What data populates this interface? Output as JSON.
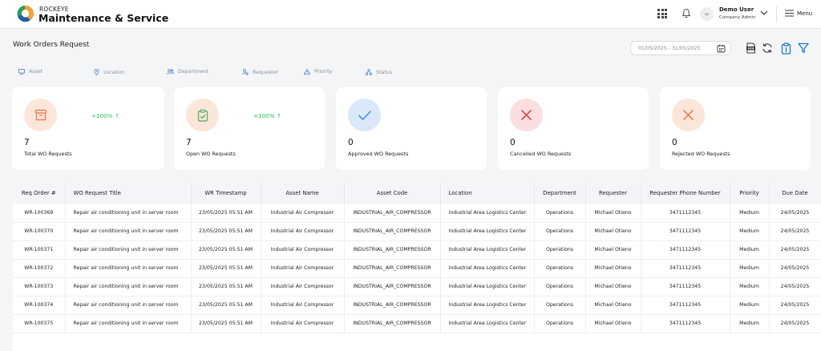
{
  "header": {
    "brand_small": "ROCKEYE",
    "brand_title": "Maintenance & Service",
    "user_name": "Demo User",
    "user_role": "Company Admin",
    "menu_label": "Menu"
  },
  "page": {
    "title": "Work Orders Request",
    "date_range": "01/05/2025 - 31/05/2025"
  },
  "filters": [
    "Asset",
    "Location",
    "Department",
    "Requester",
    "Priority",
    "Status"
  ],
  "cards": [
    {
      "value": "7",
      "label": "Total WO Requests",
      "trend": "+100% ↑",
      "icon": "package-icon",
      "color": "#e8825a"
    },
    {
      "value": "7",
      "label": "Open WO Requests",
      "trend": "+100% ↑",
      "icon": "clipboard-check-icon",
      "color": "#5fb36a"
    },
    {
      "value": "0",
      "label": "Approved WO Requests",
      "trend": "",
      "icon": "check-icon",
      "color": "#4a90e2"
    },
    {
      "value": "0",
      "label": "Cancelled WO Requests",
      "trend": "",
      "icon": "x-icon",
      "color": "#e04a4a"
    },
    {
      "value": "0",
      "label": "Rejected WO Requests",
      "trend": "",
      "icon": "x-icon",
      "color": "#e8825a"
    }
  ],
  "table": {
    "columns": [
      "Req Order #",
      "WO Request Title",
      "WR Timestamp",
      "Asset Name",
      "Asset Code",
      "Location",
      "Department",
      "Requester",
      "Requester Phone Number",
      "Priority",
      "Due Date"
    ],
    "rows": [
      [
        "WR-100369",
        "Repair air conditioning unit in server room",
        "23/05/2025 05:51 AM",
        "Industrial Air Compressor",
        "INDUSTRIAL_AIR_COMPRESSOR",
        "Industrial Area Logistics Center",
        "Operations",
        "Michael Otieno",
        "3471112345",
        "Medium",
        "24/05/2025"
      ],
      [
        "WR-100370",
        "Repair air conditioning unit in server room",
        "23/05/2025 05:51 AM",
        "Industrial Air Compressor",
        "INDUSTRIAL_AIR_COMPRESSOR",
        "Industrial Area Logistics Center",
        "Operations",
        "Michael Otieno",
        "3471112345",
        "Medium",
        "24/05/2025"
      ],
      [
        "WR-100371",
        "Repair air conditioning unit in server room",
        "23/05/2025 05:51 AM",
        "Industrial Air Compressor",
        "INDUSTRIAL_AIR_COMPRESSOR",
        "Industrial Area Logistics Center",
        "Operations",
        "Michael Otieno",
        "3471112345",
        "Medium",
        "24/05/2025"
      ],
      [
        "WR-100372",
        "Repair air conditioning unit in server room",
        "23/05/2025 05:51 AM",
        "Industrial Air Compressor",
        "INDUSTRIAL_AIR_COMPRESSOR",
        "Industrial Area Logistics Center",
        "Operations",
        "Michael Otieno",
        "3471112345",
        "Medium",
        "24/05/2025"
      ],
      [
        "WR-100373",
        "Repair air conditioning unit in server room",
        "23/05/2025 05:51 AM",
        "Industrial Air Compressor",
        "INDUSTRIAL_AIR_COMPRESSOR",
        "Industrial Area Logistics Center",
        "Operations",
        "Michael Otieno",
        "3471112345",
        "Medium",
        "24/05/2025"
      ],
      [
        "WR-100374",
        "Repair air conditioning unit in server room",
        "23/05/2025 05:51 AM",
        "Industrial Air Compressor",
        "INDUSTRIAL_AIR_COMPRESSOR",
        "Industrial Area Logistics Center",
        "Operations",
        "Michael Otieno",
        "3471112345",
        "Medium",
        "24/05/2025"
      ],
      [
        "WR-100375",
        "Repair air conditioning unit in server room",
        "23/05/2025 05:51 AM",
        "Industrial Air Compressor",
        "INDUSTRIAL_AIR_COMPRESSOR",
        "Industrial Area Logistics Center",
        "Operations",
        "Michael Otieno",
        "3471112345",
        "Medium",
        "24/05/2025"
      ]
    ]
  },
  "colors": {
    "accent": "#1677c9",
    "trend_up": "#22c55e"
  }
}
